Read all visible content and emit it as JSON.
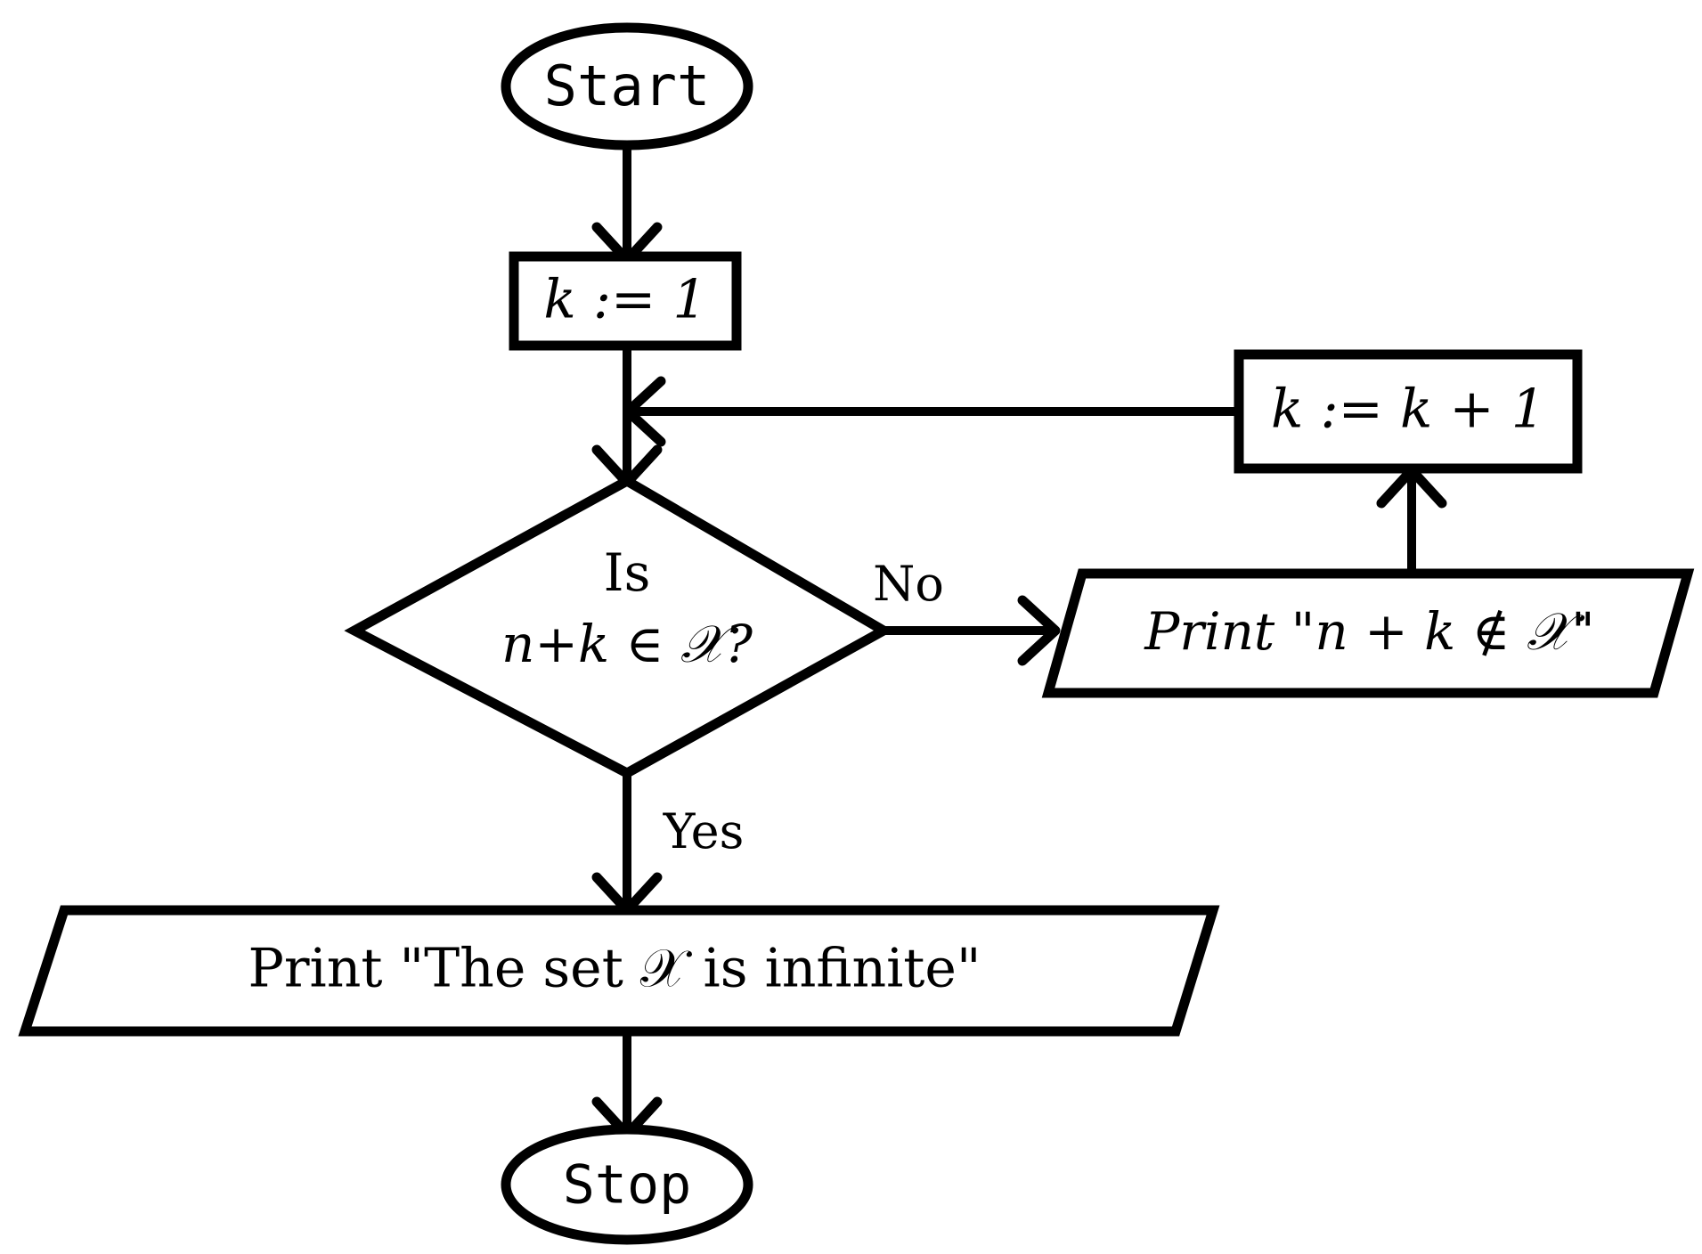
{
  "diagram": {
    "title": "Flowchart: test whether the set X is infinite",
    "background_color": "#ffffff",
    "line_color": "#000000"
  },
  "nodes": {
    "start": {
      "type": "terminator",
      "label": "Start"
    },
    "init": {
      "type": "process",
      "label": "k := 1"
    },
    "decision": {
      "type": "decision",
      "label_line1": "Is",
      "label_line2": "n+k ∈ 𝒳?"
    },
    "increment": {
      "type": "process",
      "label": "k := k + 1"
    },
    "print_not_member": {
      "type": "input-output",
      "label": "Print \"n + k ∉ 𝒳\""
    },
    "print_infinite": {
      "type": "input-output",
      "label": "Print \"The set 𝒳 is infinite\""
    },
    "stop": {
      "type": "terminator",
      "label": "Stop"
    }
  },
  "edge_labels": {
    "no": "No",
    "yes": "Yes"
  },
  "edges": [
    {
      "from": "start",
      "to": "init",
      "label": ""
    },
    {
      "from": "init",
      "to": "decision",
      "label": ""
    },
    {
      "from": "decision",
      "to": "print_not_member",
      "label": "No"
    },
    {
      "from": "print_not_member",
      "to": "increment",
      "label": ""
    },
    {
      "from": "increment",
      "to": "decision",
      "label": ""
    },
    {
      "from": "decision",
      "to": "print_infinite",
      "label": "Yes"
    },
    {
      "from": "print_infinite",
      "to": "stop",
      "label": ""
    }
  ]
}
